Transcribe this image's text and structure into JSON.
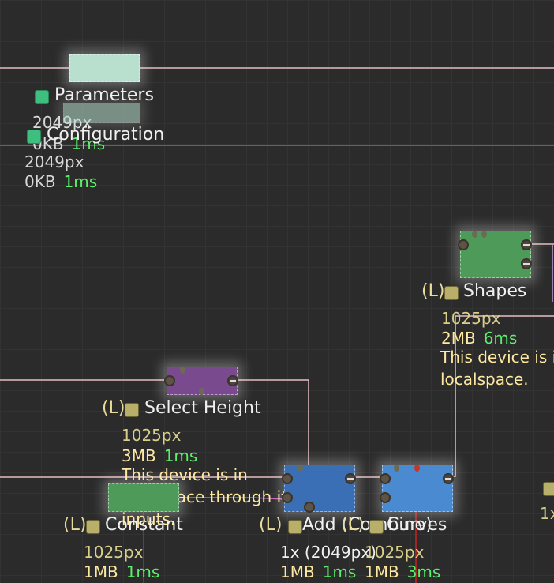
{
  "colors": {
    "canvas": "#2b2b2b",
    "grid": "#333333",
    "wire_pink": "#e6bcc2",
    "wire_teal": "#3f8f7a",
    "wire_red": "#cc2222",
    "timing_green": "#5cf06a",
    "mem_yellow": "#ffe9a0",
    "res_olive": "#d8cf8a",
    "chip_olive": "#b8b06a",
    "chip_green": "#3fbf7f"
  },
  "nodes": {
    "parameters": {
      "title": "Parameters",
      "res": "2049px",
      "mem": "0KB",
      "time": "1ms",
      "color": "#b9e0cf"
    },
    "configuration": {
      "title": "Configuration",
      "res": "2049px",
      "mem": "0KB",
      "time": "1ms",
      "color": "#b9e0cf"
    },
    "shapes": {
      "local": "(L)",
      "title": "Shapes",
      "res": "1025px",
      "mem": "2MB",
      "time": "6ms",
      "note1": "This device is in",
      "note2": "localspace.",
      "color": "#4e9a58"
    },
    "select_height": {
      "local": "(L)",
      "title": "Select Height",
      "res": "1025px",
      "mem": "3MB",
      "time": "1ms",
      "note1": "This device is in",
      "note2": "localspace through its",
      "note3": "inputs.",
      "color": "#7a4a8e"
    },
    "constant": {
      "local": "(L)",
      "title": "Constant",
      "res": "1025px",
      "mem": "1MB",
      "time": "1ms",
      "color": "#4e9a58"
    },
    "add": {
      "local": "(L)",
      "title": "Add (Combine)",
      "res": "1x (2049px)",
      "mem": "1MB",
      "time": "1ms",
      "color": "#3a6fb5"
    },
    "curves": {
      "local": "(L)",
      "title": "Curves",
      "res": "1025px",
      "mem": "1MB",
      "time": "3ms",
      "color": "#4a8ad0"
    },
    "partial_right": {
      "res": "1x"
    }
  }
}
